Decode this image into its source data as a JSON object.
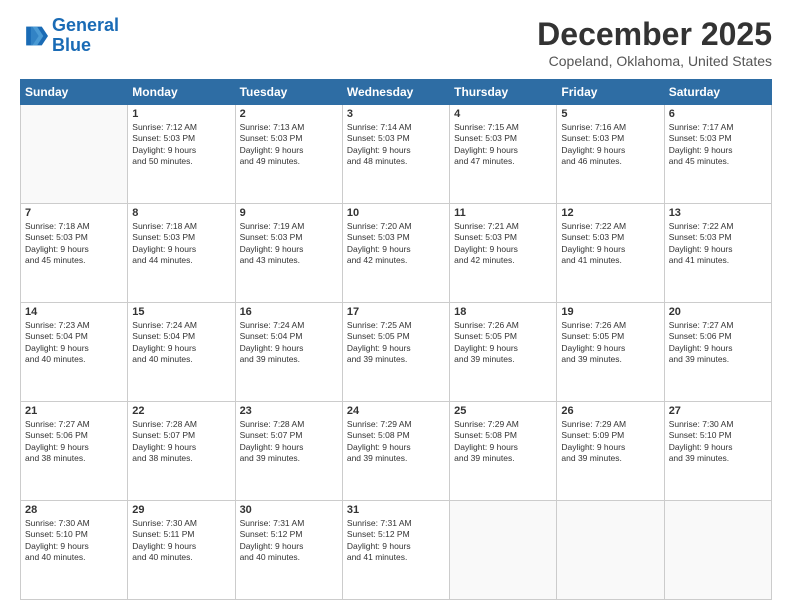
{
  "header": {
    "logo_line1": "General",
    "logo_line2": "Blue",
    "month": "December 2025",
    "location": "Copeland, Oklahoma, United States"
  },
  "days_of_week": [
    "Sunday",
    "Monday",
    "Tuesday",
    "Wednesday",
    "Thursday",
    "Friday",
    "Saturday"
  ],
  "weeks": [
    [
      {
        "num": "",
        "info": ""
      },
      {
        "num": "1",
        "info": "Sunrise: 7:12 AM\nSunset: 5:03 PM\nDaylight: 9 hours\nand 50 minutes."
      },
      {
        "num": "2",
        "info": "Sunrise: 7:13 AM\nSunset: 5:03 PM\nDaylight: 9 hours\nand 49 minutes."
      },
      {
        "num": "3",
        "info": "Sunrise: 7:14 AM\nSunset: 5:03 PM\nDaylight: 9 hours\nand 48 minutes."
      },
      {
        "num": "4",
        "info": "Sunrise: 7:15 AM\nSunset: 5:03 PM\nDaylight: 9 hours\nand 47 minutes."
      },
      {
        "num": "5",
        "info": "Sunrise: 7:16 AM\nSunset: 5:03 PM\nDaylight: 9 hours\nand 46 minutes."
      },
      {
        "num": "6",
        "info": "Sunrise: 7:17 AM\nSunset: 5:03 PM\nDaylight: 9 hours\nand 45 minutes."
      }
    ],
    [
      {
        "num": "7",
        "info": "Sunrise: 7:18 AM\nSunset: 5:03 PM\nDaylight: 9 hours\nand 45 minutes."
      },
      {
        "num": "8",
        "info": "Sunrise: 7:18 AM\nSunset: 5:03 PM\nDaylight: 9 hours\nand 44 minutes."
      },
      {
        "num": "9",
        "info": "Sunrise: 7:19 AM\nSunset: 5:03 PM\nDaylight: 9 hours\nand 43 minutes."
      },
      {
        "num": "10",
        "info": "Sunrise: 7:20 AM\nSunset: 5:03 PM\nDaylight: 9 hours\nand 42 minutes."
      },
      {
        "num": "11",
        "info": "Sunrise: 7:21 AM\nSunset: 5:03 PM\nDaylight: 9 hours\nand 42 minutes."
      },
      {
        "num": "12",
        "info": "Sunrise: 7:22 AM\nSunset: 5:03 PM\nDaylight: 9 hours\nand 41 minutes."
      },
      {
        "num": "13",
        "info": "Sunrise: 7:22 AM\nSunset: 5:03 PM\nDaylight: 9 hours\nand 41 minutes."
      }
    ],
    [
      {
        "num": "14",
        "info": "Sunrise: 7:23 AM\nSunset: 5:04 PM\nDaylight: 9 hours\nand 40 minutes."
      },
      {
        "num": "15",
        "info": "Sunrise: 7:24 AM\nSunset: 5:04 PM\nDaylight: 9 hours\nand 40 minutes."
      },
      {
        "num": "16",
        "info": "Sunrise: 7:24 AM\nSunset: 5:04 PM\nDaylight: 9 hours\nand 39 minutes."
      },
      {
        "num": "17",
        "info": "Sunrise: 7:25 AM\nSunset: 5:05 PM\nDaylight: 9 hours\nand 39 minutes."
      },
      {
        "num": "18",
        "info": "Sunrise: 7:26 AM\nSunset: 5:05 PM\nDaylight: 9 hours\nand 39 minutes."
      },
      {
        "num": "19",
        "info": "Sunrise: 7:26 AM\nSunset: 5:05 PM\nDaylight: 9 hours\nand 39 minutes."
      },
      {
        "num": "20",
        "info": "Sunrise: 7:27 AM\nSunset: 5:06 PM\nDaylight: 9 hours\nand 39 minutes."
      }
    ],
    [
      {
        "num": "21",
        "info": "Sunrise: 7:27 AM\nSunset: 5:06 PM\nDaylight: 9 hours\nand 38 minutes."
      },
      {
        "num": "22",
        "info": "Sunrise: 7:28 AM\nSunset: 5:07 PM\nDaylight: 9 hours\nand 38 minutes."
      },
      {
        "num": "23",
        "info": "Sunrise: 7:28 AM\nSunset: 5:07 PM\nDaylight: 9 hours\nand 39 minutes."
      },
      {
        "num": "24",
        "info": "Sunrise: 7:29 AM\nSunset: 5:08 PM\nDaylight: 9 hours\nand 39 minutes."
      },
      {
        "num": "25",
        "info": "Sunrise: 7:29 AM\nSunset: 5:08 PM\nDaylight: 9 hours\nand 39 minutes."
      },
      {
        "num": "26",
        "info": "Sunrise: 7:29 AM\nSunset: 5:09 PM\nDaylight: 9 hours\nand 39 minutes."
      },
      {
        "num": "27",
        "info": "Sunrise: 7:30 AM\nSunset: 5:10 PM\nDaylight: 9 hours\nand 39 minutes."
      }
    ],
    [
      {
        "num": "28",
        "info": "Sunrise: 7:30 AM\nSunset: 5:10 PM\nDaylight: 9 hours\nand 40 minutes."
      },
      {
        "num": "29",
        "info": "Sunrise: 7:30 AM\nSunset: 5:11 PM\nDaylight: 9 hours\nand 40 minutes."
      },
      {
        "num": "30",
        "info": "Sunrise: 7:31 AM\nSunset: 5:12 PM\nDaylight: 9 hours\nand 40 minutes."
      },
      {
        "num": "31",
        "info": "Sunrise: 7:31 AM\nSunset: 5:12 PM\nDaylight: 9 hours\nand 41 minutes."
      },
      {
        "num": "",
        "info": ""
      },
      {
        "num": "",
        "info": ""
      },
      {
        "num": "",
        "info": ""
      }
    ]
  ]
}
